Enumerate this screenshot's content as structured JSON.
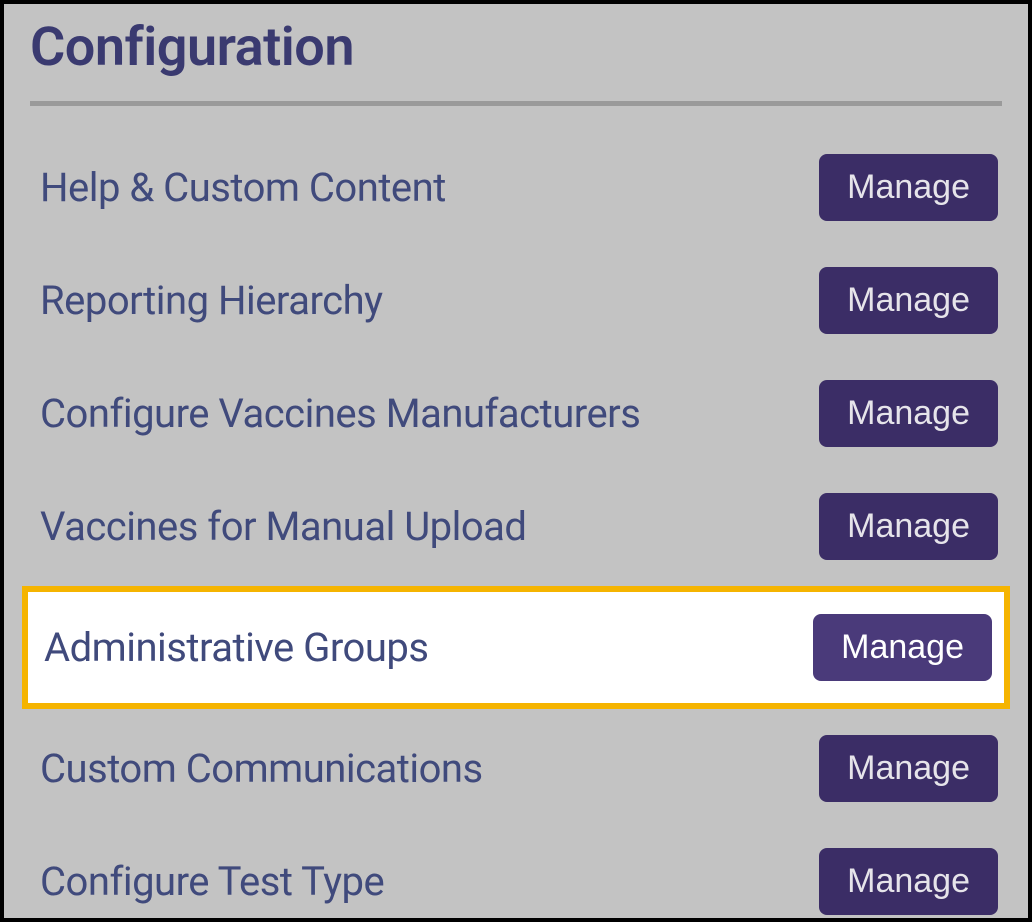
{
  "title": "Configuration",
  "items": [
    {
      "label": "Help & Custom Content",
      "button": "Manage",
      "highlighted": false
    },
    {
      "label": "Reporting Hierarchy",
      "button": "Manage",
      "highlighted": false
    },
    {
      "label": "Configure Vaccines Manufacturers",
      "button": "Manage",
      "highlighted": false
    },
    {
      "label": "Vaccines for Manual Upload",
      "button": "Manage",
      "highlighted": false
    },
    {
      "label": "Administrative Groups",
      "button": "Manage",
      "highlighted": true
    },
    {
      "label": "Custom Communications",
      "button": "Manage",
      "highlighted": false
    },
    {
      "label": "Configure Test Type",
      "button": "Manage",
      "highlighted": false
    }
  ]
}
